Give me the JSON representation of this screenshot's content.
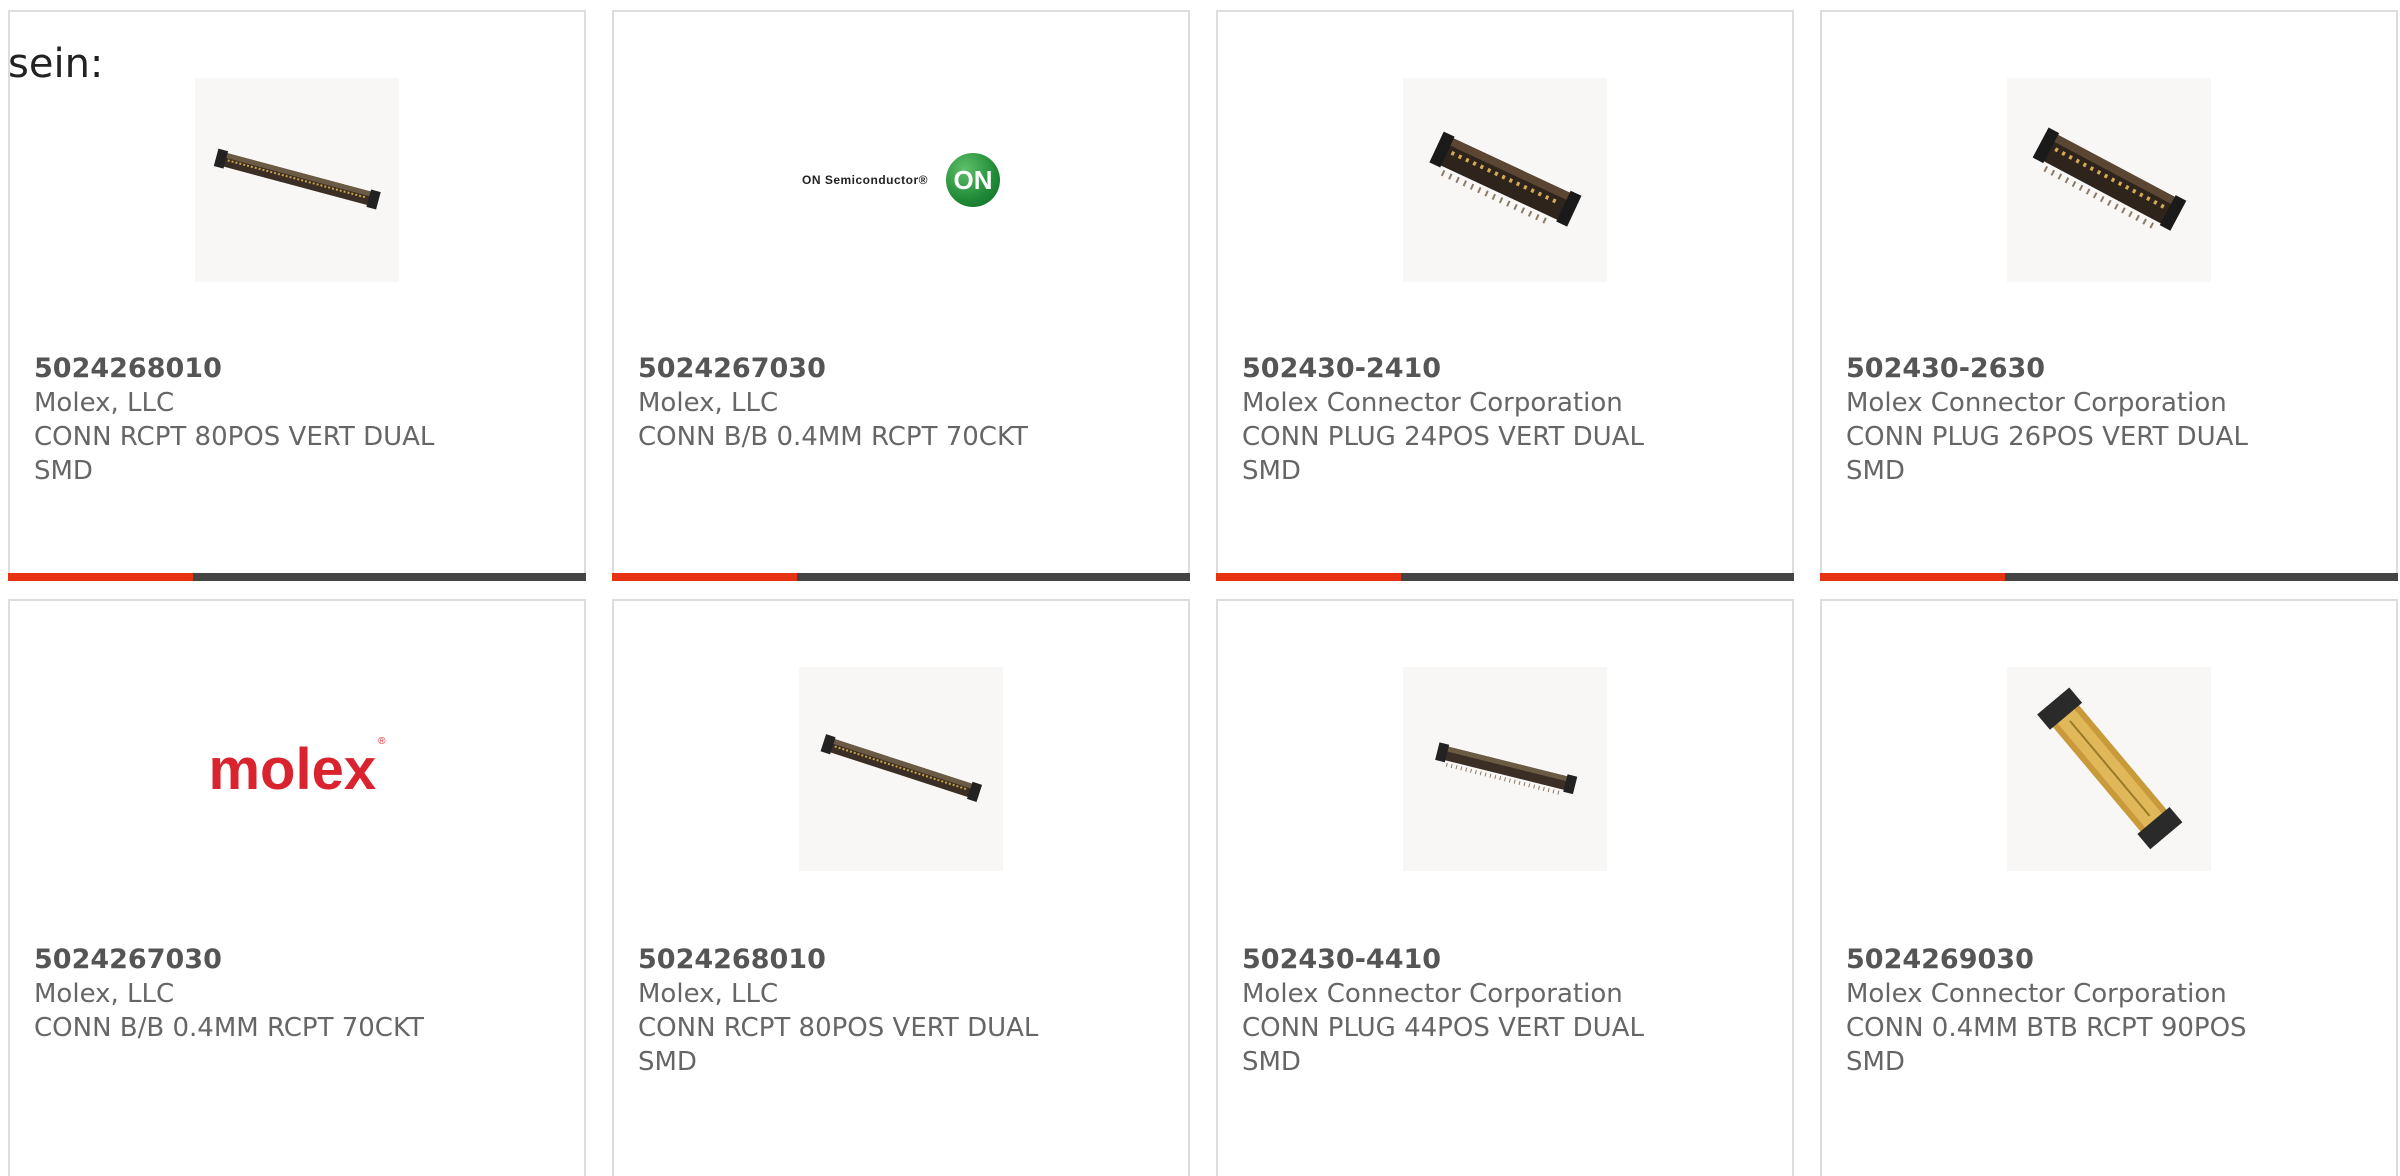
{
  "page_label": "sein:",
  "colors": {
    "progress_fill": "#e63312",
    "progress_track": "#444444",
    "card_border": "#dddddd",
    "molex_red": "#d9232e",
    "on_green": "#1f8a36"
  },
  "cards": [
    {
      "part_number": "5024268010",
      "manufacturer": "Molex, LLC",
      "description": "CONN RCPT 80POS VERT DUAL SMD",
      "image": "connector-strip-image",
      "progress": 0.32
    },
    {
      "part_number": "5024267030",
      "manufacturer": "Molex, LLC",
      "description": "CONN B/B 0.4MM RCPT 70CKT",
      "image": "on-semiconductor-logo",
      "logo_text": "ON Semiconductor®",
      "logo_mark": "ON",
      "progress": 0.32
    },
    {
      "part_number": "502430-2410",
      "manufacturer": "Molex Connector Corporation",
      "description": "CONN PLUG 24POS VERT DUAL SMD",
      "image": "connector-plug-image",
      "progress": 0.32
    },
    {
      "part_number": "502430-2630",
      "manufacturer": "Molex Connector Corporation",
      "description": "CONN PLUG 26POS VERT DUAL SMD",
      "image": "connector-plug-image",
      "progress": 0.32
    },
    {
      "part_number": "5024267030",
      "manufacturer": "Molex, LLC",
      "description": "CONN B/B 0.4MM RCPT 70CKT",
      "image": "molex-logo",
      "logo_text": "molex"
    },
    {
      "part_number": "5024268010",
      "manufacturer": "Molex, LLC",
      "description": "CONN RCPT 80POS VERT DUAL SMD",
      "image": "connector-strip-image"
    },
    {
      "part_number": "502430-4410",
      "manufacturer": "Molex Connector Corporation",
      "description": "CONN PLUG 44POS VERT DUAL SMD",
      "image": "connector-strip-image"
    },
    {
      "part_number": "5024269030",
      "manufacturer": "Molex Connector Corporation",
      "description": "CONN 0.4MM BTB RCPT 90POS SMD",
      "image": "connector-pair-image"
    }
  ]
}
